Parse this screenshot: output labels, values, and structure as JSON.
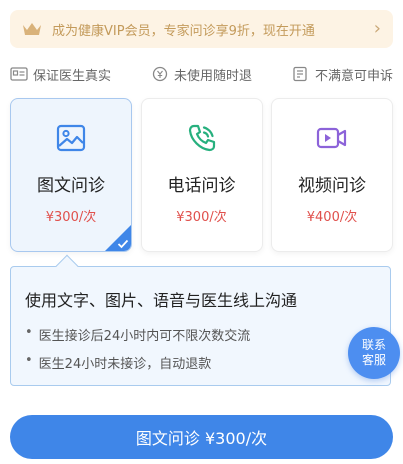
{
  "vip_banner": {
    "text": "成为健康VIP会员，专家问诊享9折，现在开通",
    "icon": "crown-icon",
    "chevron": "›"
  },
  "guarantees": [
    {
      "label": "保证医生真实",
      "icon": "id-card-icon"
    },
    {
      "label": "未使用随时退",
      "icon": "refund-icon"
    },
    {
      "label": "不满意可申诉",
      "icon": "complaint-icon"
    }
  ],
  "services": [
    {
      "title": "图文问诊",
      "price": "¥300/次",
      "icon": "image-icon",
      "color": "#3f86e8",
      "selected": true
    },
    {
      "title": "电话问诊",
      "price": "¥300/次",
      "icon": "phone-icon",
      "color": "#27b07e",
      "selected": false
    },
    {
      "title": "视频问诊",
      "price": "¥400/次",
      "icon": "video-icon",
      "color": "#8c63d9",
      "selected": false
    }
  ],
  "description": {
    "title": "使用文字、图片、语音与医生线上沟通",
    "bullets": [
      "医生接诊后24小时内可不限次数交流",
      "医生24小时未接诊，自动退款"
    ]
  },
  "contact": {
    "line1": "联系",
    "line2": "客服"
  },
  "primary_button": {
    "label": "图文问诊 ¥300/次"
  },
  "colors": {
    "accent": "#3f86e8",
    "price": "#e0504c",
    "vip_gold": "#c39a5a"
  }
}
